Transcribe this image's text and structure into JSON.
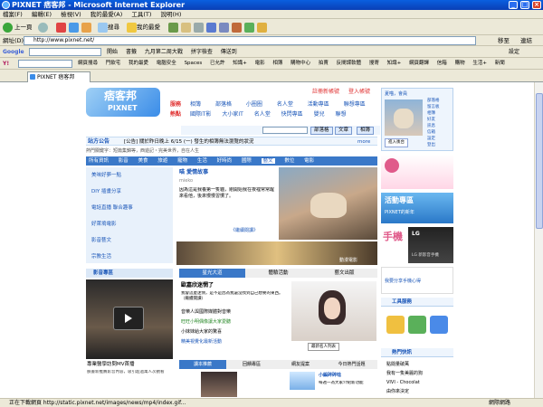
{
  "window": {
    "title": "PIXNET 痞客邦 - Microsoft Internet Explorer",
    "min": "_",
    "max": "□",
    "close": "×"
  },
  "menu": [
    "檔案(F)",
    "編輯(E)",
    "檢視(V)",
    "我的最愛(A)",
    "工具(T)",
    "說明(H)"
  ],
  "toolbar": {
    "back": "上一頁",
    "search": "搜尋",
    "favorites": "我的最愛"
  },
  "address": {
    "label": "網址(D)",
    "url": "http://www.pixnet.net/",
    "go": "移至",
    "links": "連結"
  },
  "google": {
    "logo": "Google",
    "items": [
      "開始",
      "書籤",
      "九月第二周大戰",
      "拼字檢查",
      "傳送到",
      "設定"
    ]
  },
  "yahoo": {
    "logo": "Y!",
    "items": [
      "網頁搜尋",
      "門飲宅",
      "我的最愛",
      "電腦安全",
      "Spaces",
      "已允許",
      "知識+",
      "電影",
      "相簿",
      "購物中心",
      "拍賣",
      "反間諜軟體",
      "搜寄",
      "知識+",
      "網頁翻譯",
      "信箱",
      "購物",
      "生活+",
      "新聞"
    ]
  },
  "tab": {
    "label": "PIXNET 痞客邦"
  },
  "page": {
    "logo_cn": "痞客邦",
    "logo_en": "PIXNET",
    "nav_row1_label": "服務",
    "nav_row1": [
      "相簿",
      "部落格",
      "小圈圈",
      "名人堂",
      "活動專區",
      "聯想專區"
    ],
    "nav_row2_label": "熱點",
    "nav_row2": [
      "國際IT影",
      "大小家IT",
      "名人堂",
      "快閃專區",
      "嬰兒",
      "聯想"
    ],
    "top_links": [
      "註冊新帳號",
      "登入帳號"
    ],
    "search_btns": [
      "部落格",
      "文章",
      "相簿"
    ],
    "announce_label": "站方公告",
    "announce": "[公告] 關於昨日晚上 6/15 (一) 發生的相簿無法瀏覽的狀況",
    "announce_more": "more",
    "ticker": "熱門關鍵字：短篇集錦等，西遊記・完美世界，自在人生",
    "cats": [
      "所有資訊",
      "影音",
      "美食",
      "旅遊",
      "寵物",
      "生活",
      "好時尚",
      "國際",
      "藝文",
      "數位",
      "電影"
    ],
    "left_list": [
      "美味好夢一點",
      "DIY 插畫分享",
      "電話直播 聯合趣事",
      "好萊塢電影",
      "影音藝文",
      "宗教生活"
    ],
    "feature_title": "喵 愛情故事",
    "feature_by": "mieko",
    "feature_body": "因為這是我養第一隻貓，剛開始我在夜裡常常醒來看他，後來慢慢習慣了。",
    "feature_more": "《繼續閱讀》",
    "feature_caption": "動漫電影",
    "mvp_title": "影音專區",
    "mvp_cap": "專業醫學訪問MV首播",
    "mvp_desc": "臉書新推薦影音內容，吸引超過萬人次觀看",
    "mid_tabs": [
      "星光大道",
      "體驗活動",
      "藝文出版"
    ],
    "mid_title": "歐嘉欣迷惘了",
    "mid_body": "我會這麼迷惘，是不是因為我還沒找到自己想要的東西。（繼續閱讀）",
    "mid_links": [
      "音樂人與國際媒體對音樂",
      "旺旺小明偶像讓大家愛聽",
      "小妹妹給大家的驚喜",
      "精美視覺化最新活動"
    ],
    "mid_img_caption": "最新名人列表",
    "bottom_tabs": [
      "讀本推薦",
      "回饋專區",
      "網友提案",
      "今日熱門話題"
    ],
    "bottom_right_title": "小編碎碎唸",
    "bottom_right_body": "每週一為大家介紹新功能",
    "right_user": "夏喵，會員",
    "right_links": [
      "部落格",
      "留言板",
      "相簿",
      "好友",
      "訊息",
      "信箱",
      "設定",
      "登出"
    ],
    "right_login": "進入後台",
    "ad1": "活動專區",
    "ad2": "PIXNET的新年",
    "ad3_title": "LG",
    "ad3_body": "LG 新影音手機",
    "ad4": "我要分享手機心得",
    "tools_title": "工具服務",
    "quick_title": "熱門快訊",
    "quick": [
      "點閱量破萬",
      "我有一隻美麗的狗",
      "VIVI - Chocolat",
      "由你來決定"
    ]
  },
  "status": {
    "text": "正在下載網頁 http://static.pixnet.net/images/news/mp4/index.gif...",
    "zone": "網際網路"
  },
  "colors": {
    "accent": "#1a56b8",
    "title_bar": "#0a4fd0",
    "pixnet_blue": "#3a8ce8"
  }
}
